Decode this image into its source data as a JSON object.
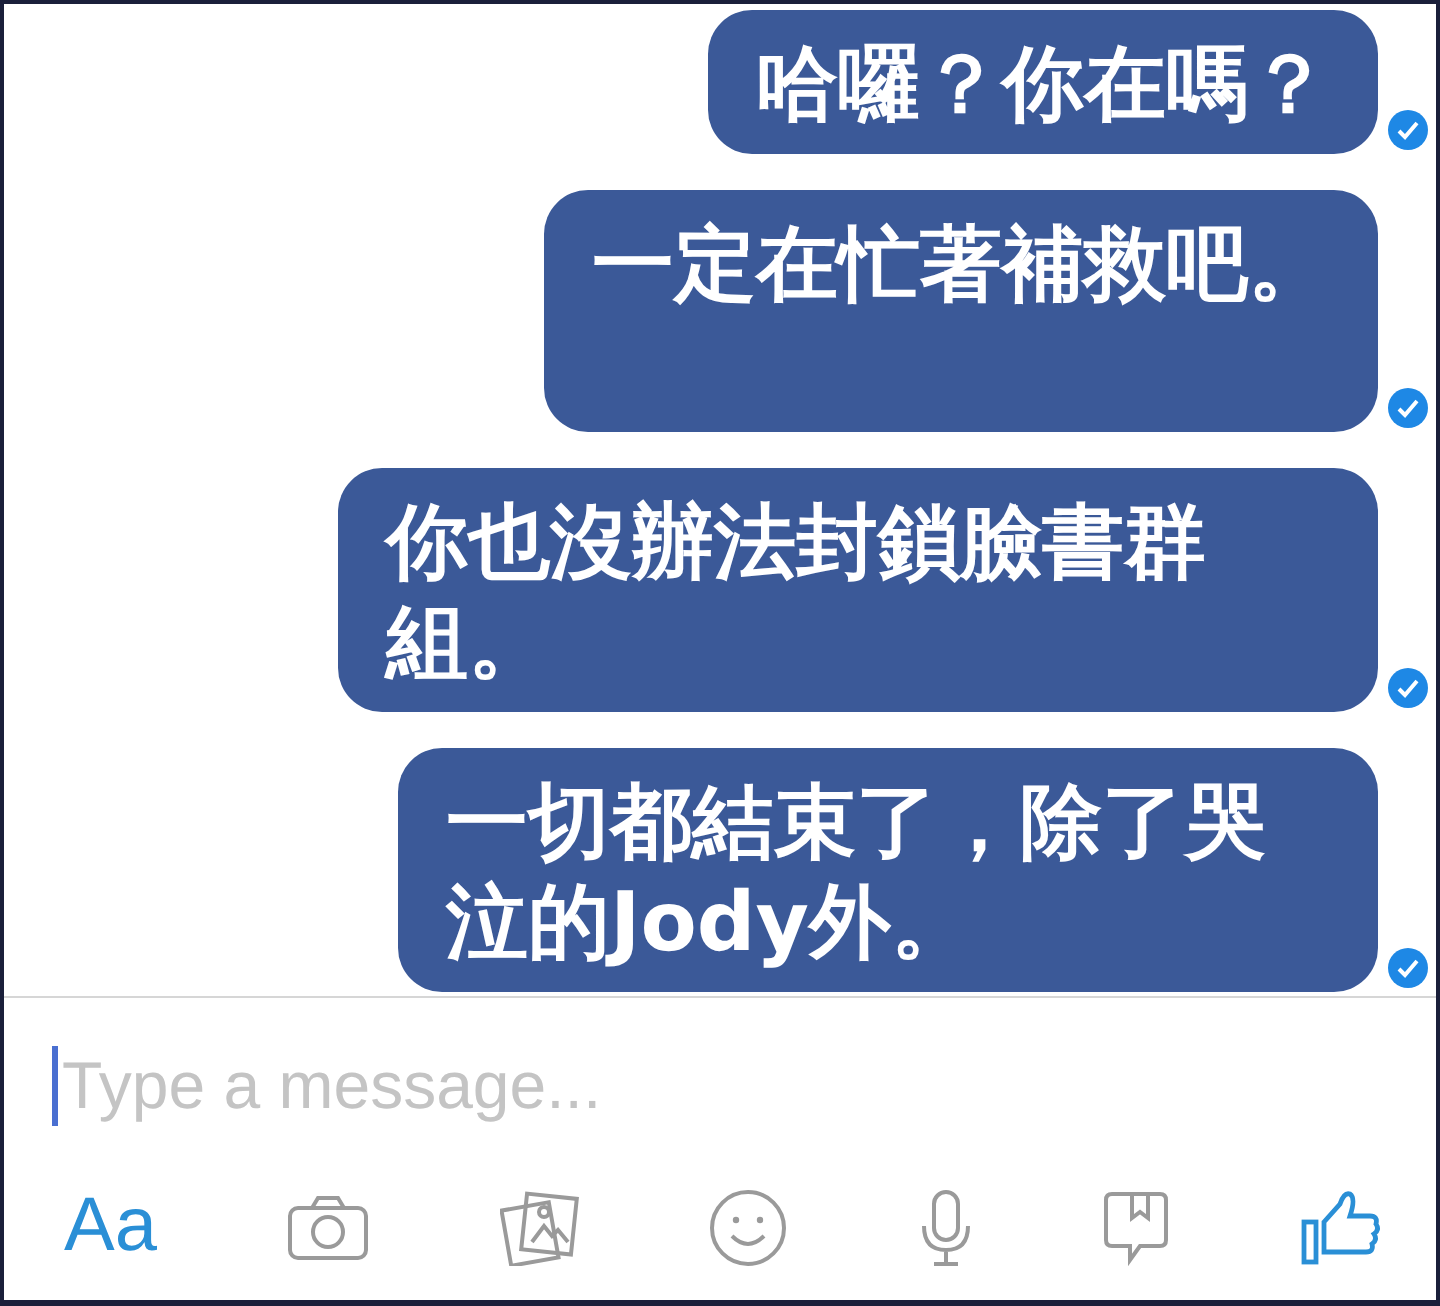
{
  "messages": [
    {
      "text": "哈囉？你在嗎？",
      "delivered": true
    },
    {
      "text": "一定在忙著補救吧。",
      "delivered": true
    },
    {
      "text": "你也沒辦法封鎖臉書群組。",
      "delivered": true
    },
    {
      "text": "一切都結束了，除了哭泣的Jody外。",
      "delivered": true
    }
  ],
  "composer": {
    "placeholder": "Type a message..."
  },
  "toolbar": [
    {
      "kind": "text",
      "label": "Aa"
    },
    {
      "kind": "camera"
    },
    {
      "kind": "gallery"
    },
    {
      "kind": "emoji"
    },
    {
      "kind": "mic"
    },
    {
      "kind": "sticker"
    },
    {
      "kind": "like"
    }
  ]
}
